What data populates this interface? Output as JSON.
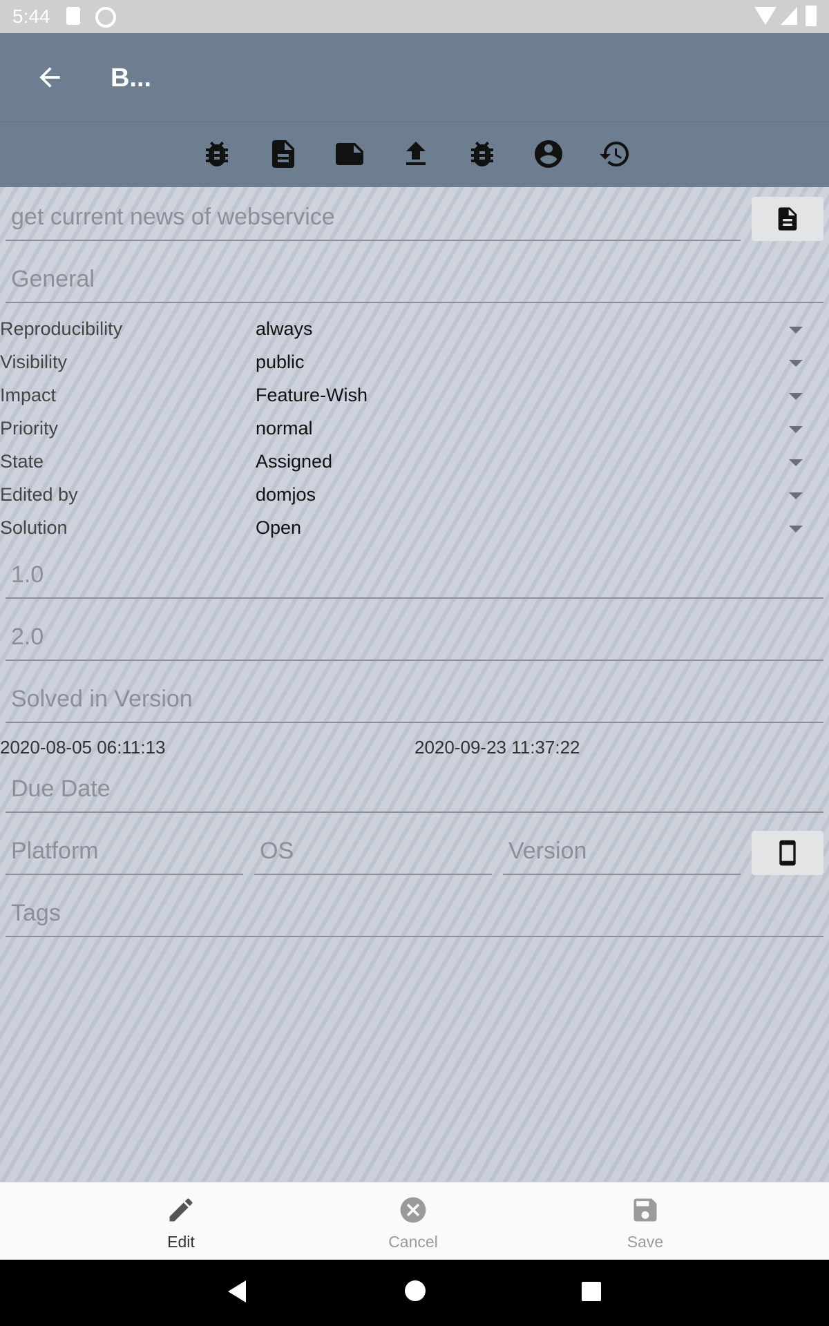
{
  "status_bar": {
    "time": "5:44"
  },
  "app_bar": {
    "title": "B..."
  },
  "toolbar": {
    "icons": [
      "bug-icon",
      "document-icon",
      "note-icon",
      "upload-icon",
      "bug-icon",
      "account-icon",
      "history-icon"
    ]
  },
  "form": {
    "summary_placeholder": "get current news of webservice",
    "category_placeholder": "General",
    "rows": [
      {
        "label": "Reproducibility",
        "value": "always"
      },
      {
        "label": "Visibility",
        "value": "public"
      },
      {
        "label": "Impact",
        "value": "Feature-Wish"
      },
      {
        "label": "Priority",
        "value": "normal"
      },
      {
        "label": "State",
        "value": "Assigned"
      },
      {
        "label": "Edited by",
        "value": "domjos"
      },
      {
        "label": "Solution",
        "value": "Open"
      }
    ],
    "version_placeholder": "1.0",
    "target_version_placeholder": "2.0",
    "solved_version_placeholder": "Solved in Version",
    "created_date": "2020-08-05 06:11:13",
    "updated_date": "2020-09-23 11:37:22",
    "due_date_placeholder": "Due Date",
    "platform_placeholder": "Platform",
    "os_placeholder": "OS",
    "os_version_placeholder": "Version",
    "tags_placeholder": "Tags"
  },
  "bottom_nav": {
    "edit": "Edit",
    "cancel": "Cancel",
    "save": "Save"
  },
  "colors": {
    "app_bar": "#6d7e91",
    "bottom_nav": "#fafafa",
    "disabled": "#9a9a9a"
  }
}
